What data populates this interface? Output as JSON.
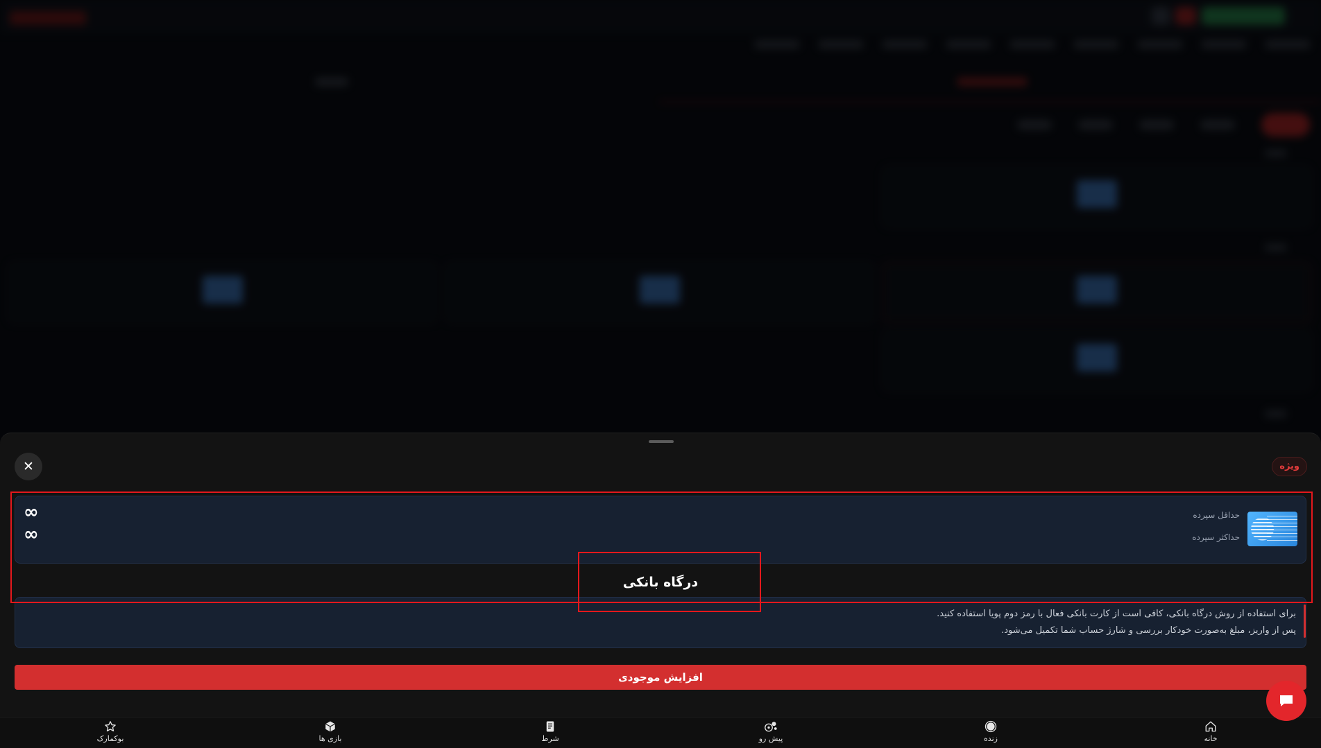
{
  "sheet": {
    "badge": "ویژه",
    "close_symbol": "✕",
    "method_card": {
      "min_label": "حداقل سپرده",
      "max_label": "حداکثر سپرده",
      "min_value": "∞",
      "max_value": "∞"
    },
    "method_title": "درگاه بانکی",
    "info_lines": [
      "برای استفاده از روش درگاه بانکی، کافی است از کارت بانکی فعال با رمز دوم پویا استفاده کنید.",
      "پس از واریز، مبلغ به‌صورت خودکار بررسی و شارژ حساب شما تکمیل می‌شود."
    ],
    "deposit_button": "افزایش موجودی"
  },
  "bottom_nav": [
    {
      "key": "bookmark",
      "label": "بوکمارک",
      "icon": "star-icon"
    },
    {
      "key": "games",
      "label": "بازی ها",
      "icon": "cube-icon"
    },
    {
      "key": "bets",
      "label": "شرط",
      "icon": "receipt-icon"
    },
    {
      "key": "prematch",
      "label": "پیش رو",
      "icon": "soccer-icon"
    },
    {
      "key": "live",
      "label": "زنده",
      "icon": "live-dot-icon"
    },
    {
      "key": "home",
      "label": "خانه",
      "icon": "home-icon"
    }
  ],
  "colors": {
    "accent": "#d32f2f",
    "card_bg": "#172131",
    "sheet_bg": "#131313",
    "highlight": "#e4181c"
  }
}
